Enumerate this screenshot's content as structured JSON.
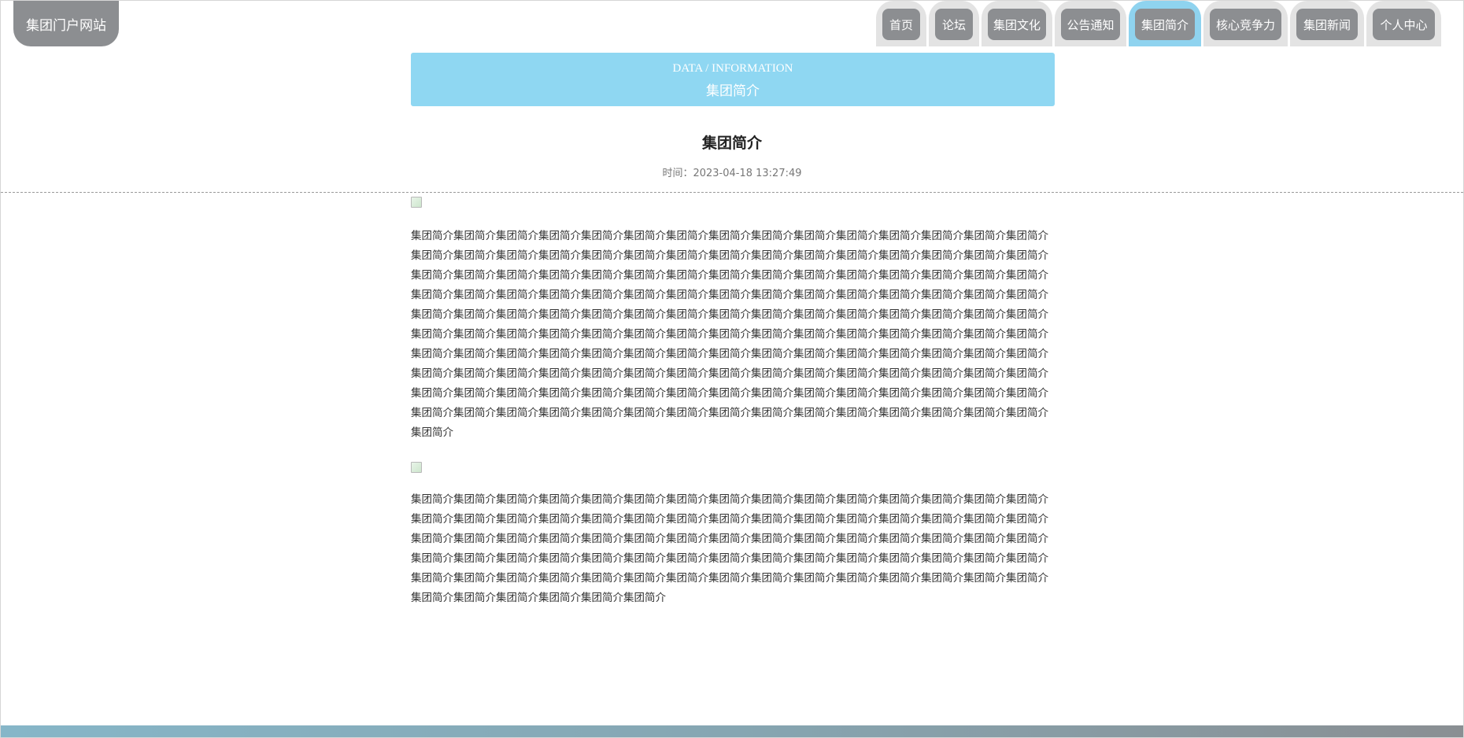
{
  "header": {
    "site_title": "集团门户网站",
    "nav": [
      {
        "label": "首页",
        "active": false
      },
      {
        "label": "论坛",
        "active": false
      },
      {
        "label": "集团文化",
        "active": false
      },
      {
        "label": "公告通知",
        "active": false
      },
      {
        "label": "集团简介",
        "active": true
      },
      {
        "label": "核心竞争力",
        "active": false
      },
      {
        "label": "集团新闻",
        "active": false
      },
      {
        "label": "个人中心",
        "active": false
      }
    ]
  },
  "banner": {
    "en": "DATA / INFORMATION",
    "cn": "集团简介"
  },
  "article": {
    "title": "集团简介",
    "time": "时间：2023-04-18 13:27:49",
    "paragraph_1": "集团简介集团简介集团简介集团简介集团简介集团简介集团简介集团简介集团简介集团简介集团简介集团简介集团简介集团简介集团简介集团简介集团简介集团简介集团简介集团简介集团简介集团简介集团简介集团简介集团简介集团简介集团简介集团简介集团简介集团简介集团简介集团简介集团简介集团简介集团简介集团简介集团简介集团简介集团简介集团简介集团简介集团简介集团简介集团简介集团简介集团简介集团简介集团简介集团简介集团简介集团简介集团简介集团简介集团简介集团简介集团简介集团简介集团简介集团简介集团简介集团简介集团简介集团简介集团简介集团简介集团简介集团简介集团简介集团简介集团简介集团简介集团简介集团简介集团简介集团简介集团简介集团简介集团简介集团简介集团简介集团简介集团简介集团简介集团简介集团简介集团简介集团简介集团简介集团简介集团简介集团简介集团简介集团简介集团简介集团简介集团简介集团简介集团简介集团简介集团简介集团简介集团简介集团简介集团简介集团简介集团简介集团简介集团简介集团简介集团简介集团简介集团简介集团简介集团简介集团简介集团简介集团简介集团简介集团简介集团简介集团简介集团简介集团简介集团简介集团简介集团简介集团简介集团简介集团简介集团简介集团简介集团简介集团简介集团简介集团简介集团简介集团简介集团简介集团简介集团简介集团简介集团简介集团简介集团简介集团简介集团简介集团简介集团简介集团简介集团简介集团简介",
    "paragraph_2": "集团简介集团简介集团简介集团简介集团简介集团简介集团简介集团简介集团简介集团简介集团简介集团简介集团简介集团简介集团简介集团简介集团简介集团简介集团简介集团简介集团简介集团简介集团简介集团简介集团简介集团简介集团简介集团简介集团简介集团简介集团简介集团简介集团简介集团简介集团简介集团简介集团简介集团简介集团简介集团简介集团简介集团简介集团简介集团简介集团简介集团简介集团简介集团简介集团简介集团简介集团简介集团简介集团简介集团简介集团简介集团简介集团简介集团简介集团简介集团简介集团简介集团简介集团简介集团简介集团简介集团简介集团简介集团简介集团简介集团简介集团简介集团简介集团简介集团简介集团简介集团简介集团简介集团简介集团简介集团简介集团简介"
  },
  "colors": {
    "banner_bg": "#8fd7f2",
    "nav_tab_bg": "#8c8e91",
    "active_tab_outline": "#8fd3ef"
  }
}
